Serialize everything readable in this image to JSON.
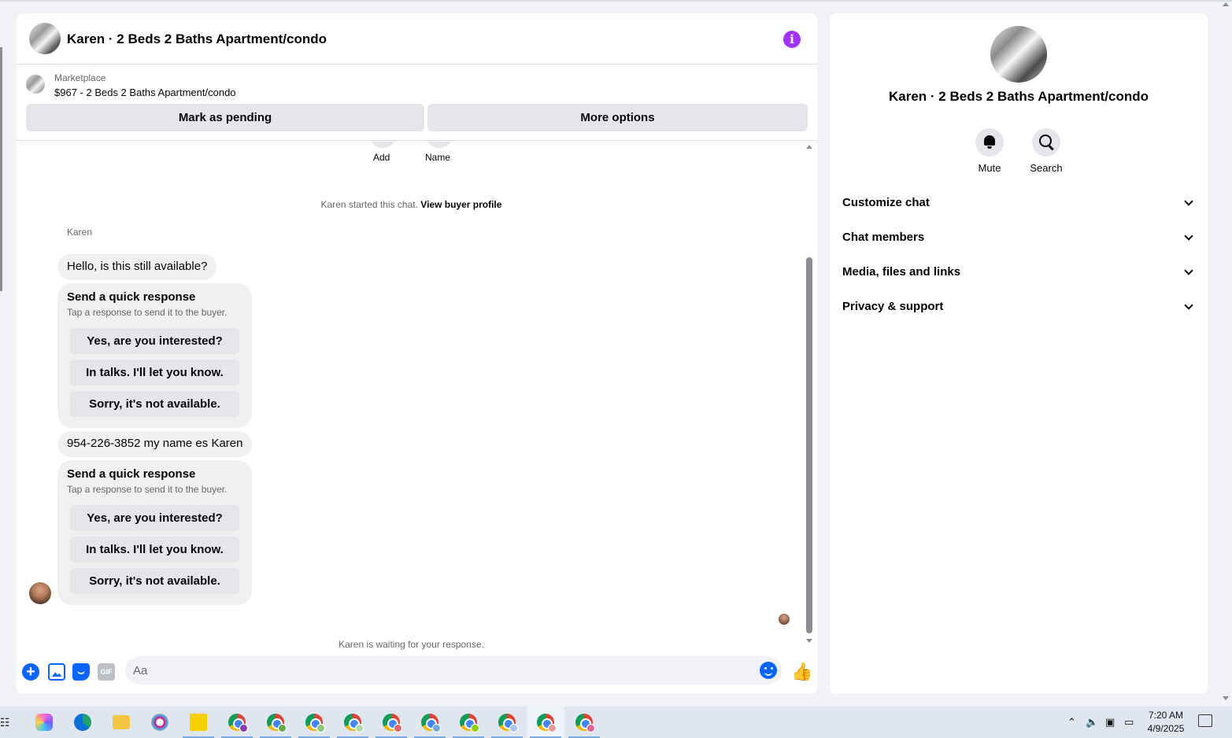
{
  "chat": {
    "title": "Karen · 2 Beds 2 Baths Apartment/condo",
    "info_icon": "info-icon",
    "listing": {
      "source": "Marketplace",
      "title": "$967 - 2 Beds 2 Baths Apartment/condo",
      "buttons": {
        "pending": "Mark as pending",
        "more": "More options"
      }
    },
    "top_actions": {
      "add": "Add",
      "name": "Name"
    },
    "started_text": "Karen started this chat.",
    "view_profile": "View buyer profile",
    "sender_name": "Karen",
    "message1": "Hello, is this still available?",
    "quick1": {
      "title": "Send a quick response",
      "subtitle": "Tap a response to send it to the buyer.",
      "options": [
        "Yes, are you interested?",
        "In talks. I'll let you know.",
        "Sorry, it's not available."
      ]
    },
    "message2": "954-226-3852 my name es Karen",
    "quick2": {
      "title": "Send a quick response",
      "subtitle": "Tap a response to send it to the buyer.",
      "options": [
        "Yes, are you interested?",
        "In talks. I'll let you know.",
        "Sorry, it's not available."
      ]
    },
    "waiting_text": "Karen is waiting for your response.",
    "composer": {
      "placeholder": "Aa",
      "value": "",
      "gif_label": "GIF"
    }
  },
  "details": {
    "title": "Karen · 2 Beds 2 Baths Apartment/condo",
    "actions": [
      {
        "label": "Mute",
        "icon": "bell-icon"
      },
      {
        "label": "Search",
        "icon": "search-icon"
      }
    ],
    "sections": [
      "Customize chat",
      "Chat members",
      "Media, files and links",
      "Privacy & support"
    ]
  },
  "taskbar": {
    "time": "7:20 AM",
    "date": "4/9/2025",
    "colors": {
      "accent": "#0866ff",
      "info": "#a033ff"
    }
  }
}
